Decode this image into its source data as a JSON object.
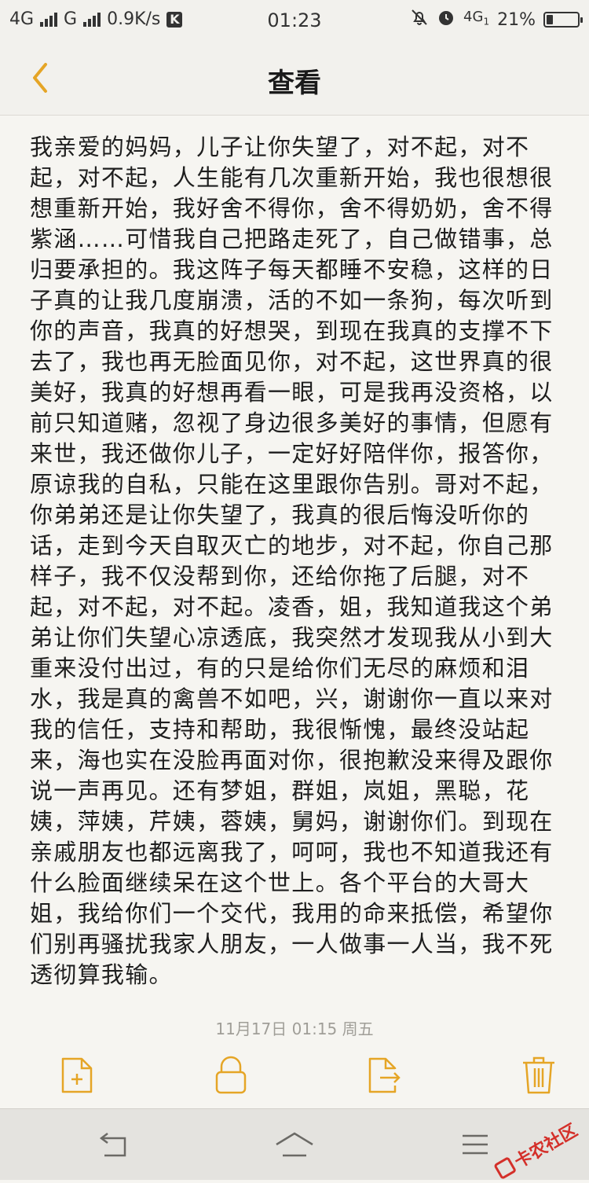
{
  "status_bar": {
    "network1": "4G",
    "network2": "G",
    "speed": "0.9K/s",
    "badge": "K",
    "time": "01:23",
    "net3": "4G",
    "net3_sub": "1",
    "battery": "21%",
    "battery_level": 0.21
  },
  "nav": {
    "title": "查看",
    "back_icon": "chevron-left-icon"
  },
  "note": {
    "body": "我亲爱的妈妈，儿子让你失望了，对不起，对不起，对不起，人生能有几次重新开始，我也很想很想重新开始，我好舍不得你，舍不得奶奶，舍不得紫涵……可惜我自己把路走死了，自己做错事，总归要承担的。我这阵子每天都睡不安稳，这样的日子真的让我几度崩溃，活的不如一条狗，每次听到你的声音，我真的好想哭，到现在我真的支撑不下去了，我也再无脸面见你，对不起，这世界真的很美好，我真的好想再看一眼，可是我再没资格，以前只知道赌，忽视了身边很多美好的事情，但愿有来世，我还做你儿子，一定好好陪伴你，报答你，原谅我的自私，只能在这里跟你告别。哥对不起，你弟弟还是让你失望了，我真的很后悔没听你的话，走到今天自取灭亡的地步，对不起，你自己那样子，我不仅没帮到你，还给你拖了后腿，对不起，对不起，对不起。凌香，姐，我知道我这个弟弟让你们失望心凉透底，我突然才发现我从小到大重来没付出过，有的只是给你们无尽的麻烦和泪水，我是真的禽兽不如吧，兴，谢谢你一直以来对我的信任，支持和帮助，我很惭愧，最终没站起来，海也实在没脸再面对你，很抱歉没来得及跟你说一声再见。还有梦姐，群姐，岚姐，黑聪，花姨，萍姨，芹姨，蓉姨，舅妈，谢谢你们。到现在亲戚朋友也都远离我了，呵呵，我也不知道我还有什么脸面继续呆在这个世上。各个平台的大哥大姐，我给你们一个交代，我用的命来抵偿，希望你们别再骚扰我家人朋友，一人做事一人当，我不死透彻算我输。",
    "date": "11月17日 01:15 周五"
  },
  "toolbar": {
    "items": [
      "new-note-icon",
      "lock-icon",
      "share-icon",
      "trash-icon"
    ]
  },
  "system_nav": {
    "items": [
      "back-icon",
      "home-icon",
      "menu-icon"
    ]
  },
  "watermark": {
    "text": "卡农社区"
  },
  "colors": {
    "accent": "#e5a526",
    "background": "#f6f5f1",
    "text": "#1e1e1e",
    "date_text": "#a09e98",
    "watermark": "#d4302a"
  }
}
